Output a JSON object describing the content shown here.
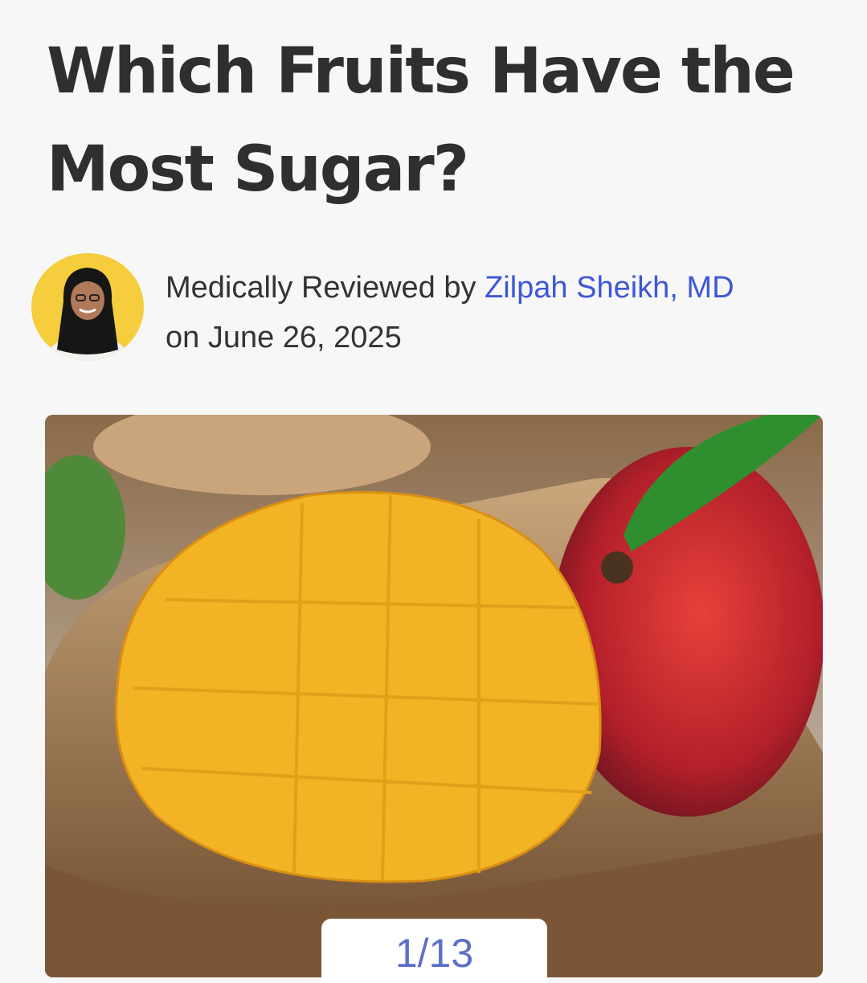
{
  "article": {
    "title": "Which Fruits Have the Most Sugar?",
    "byline": {
      "prefix": "Medically Reviewed by ",
      "reviewer": "Zilpah Sheikh, MD",
      "date_line": "on June 26, 2025"
    }
  },
  "slideshow": {
    "counter": "1/13",
    "image_icon": "mango-photo"
  },
  "colors": {
    "background": "#f7f7f7",
    "title": "#2f2f2f",
    "link": "#3e57d6",
    "avatar_bg": "#f6cd3c",
    "counter_text": "#5d70c8"
  }
}
